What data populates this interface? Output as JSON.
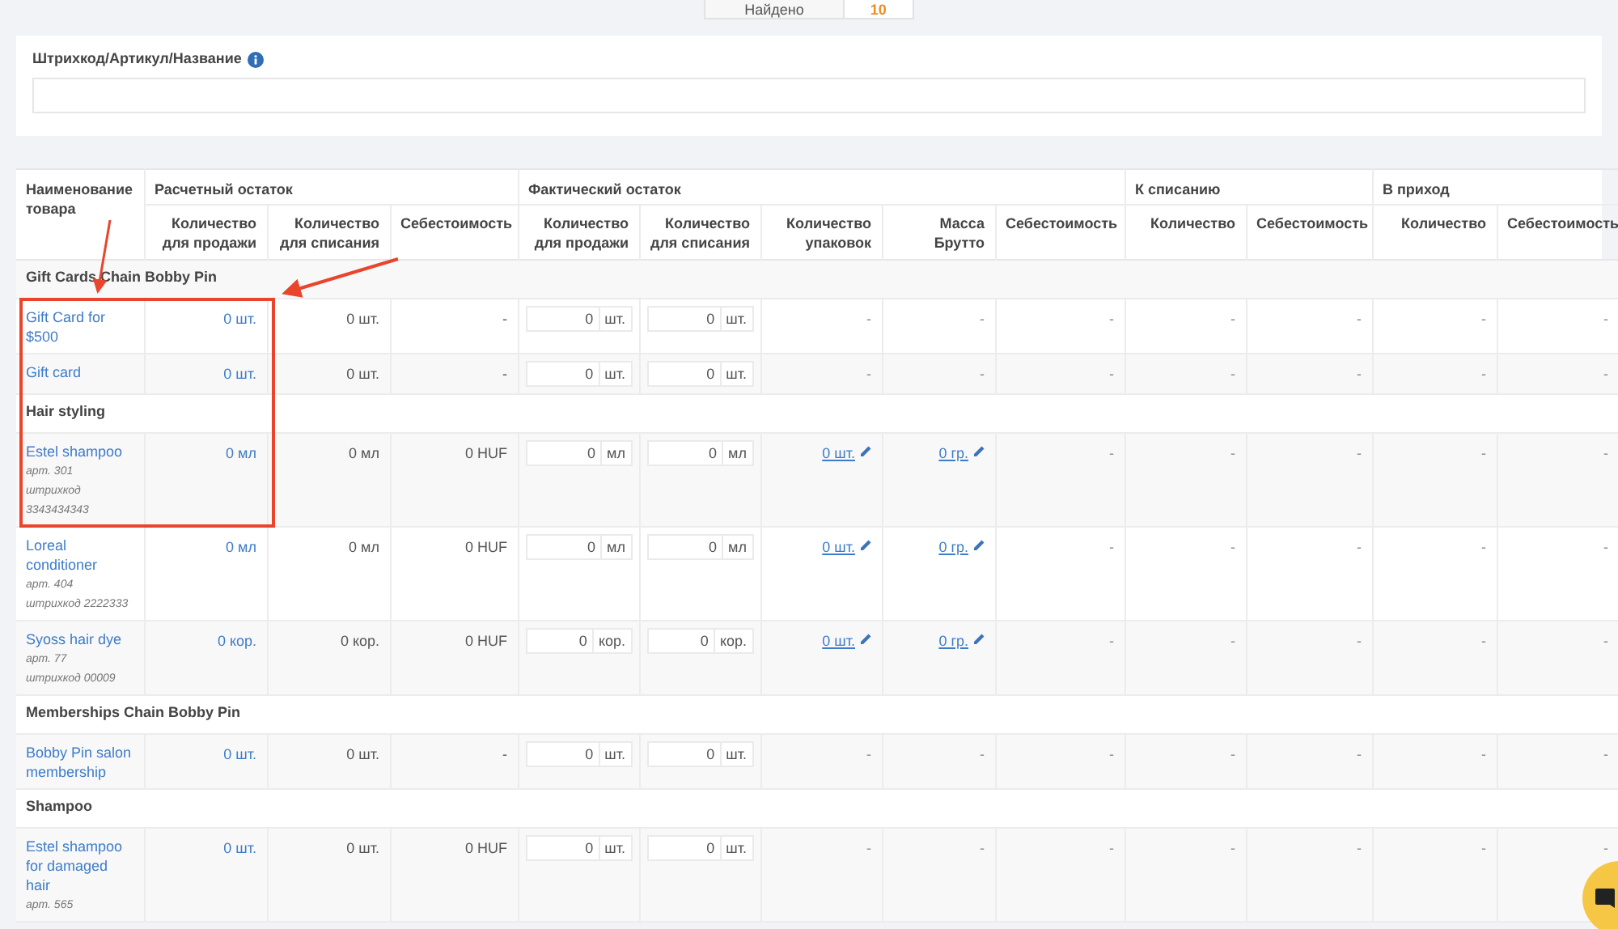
{
  "found": {
    "label": "Найдено",
    "count": "10"
  },
  "search": {
    "label": "Штрихкод/Артикул/Название"
  },
  "table": {
    "group_headers": [
      "Наименование товара",
      "Расчетный остаток",
      "Фактический остаток",
      "К списанию",
      "В приход"
    ],
    "sub_headers": [
      "Количество для продажи",
      "Количество для списания",
      "Себестоимость",
      "Количество для продажи",
      "Количество для списания",
      "Количество упаковок",
      "Масса Брутто",
      "Себестоимость",
      "Количество",
      "Себестоимость",
      "Количество",
      "Себестоимость"
    ],
    "rows": [
      {
        "kind": "group",
        "name": "Gift Cards Chain Bobby Pin"
      },
      {
        "kind": "item",
        "name": "Gift Card for $500",
        "calc": [
          "0 шт.",
          "0 шт.",
          "-"
        ],
        "inputs": [
          {
            "value": "0",
            "unit": "шт."
          },
          {
            "value": "0",
            "unit": "шт."
          }
        ],
        "rest": [
          {
            "kind": "text",
            "text": "-"
          },
          {
            "kind": "text",
            "text": "-"
          },
          {
            "kind": "text",
            "text": "-"
          },
          {
            "kind": "text",
            "text": "-"
          },
          {
            "kind": "text",
            "text": "-"
          },
          {
            "kind": "text",
            "text": "-"
          },
          {
            "kind": "text",
            "text": "-"
          }
        ]
      },
      {
        "kind": "item",
        "name": "Gift card",
        "calc": [
          "0 шт.",
          "0 шт.",
          "-"
        ],
        "inputs": [
          {
            "value": "0",
            "unit": "шт."
          },
          {
            "value": "0",
            "unit": "шт."
          }
        ],
        "rest": [
          {
            "kind": "text",
            "text": "-"
          },
          {
            "kind": "text",
            "text": "-"
          },
          {
            "kind": "text",
            "text": "-"
          },
          {
            "kind": "text",
            "text": "-"
          },
          {
            "kind": "text",
            "text": "-"
          },
          {
            "kind": "text",
            "text": "-"
          },
          {
            "kind": "text",
            "text": "-"
          }
        ]
      },
      {
        "kind": "group",
        "name": "Hair styling"
      },
      {
        "kind": "item",
        "name": "Estel shampoo",
        "meta": [
          "арт. 301",
          "штрихкод",
          "3343434343"
        ],
        "calc": [
          "0 мл",
          "0 мл",
          "0 HUF"
        ],
        "inputs": [
          {
            "value": "0",
            "unit": "мл"
          },
          {
            "value": "0",
            "unit": "мл"
          }
        ],
        "rest": [
          {
            "kind": "edit",
            "text": "0 шт."
          },
          {
            "kind": "edit",
            "text": "0 гр."
          },
          {
            "kind": "text",
            "text": "-"
          },
          {
            "kind": "text",
            "text": "-"
          },
          {
            "kind": "text",
            "text": "-"
          },
          {
            "kind": "text",
            "text": "-"
          },
          {
            "kind": "text",
            "text": "-"
          }
        ]
      },
      {
        "kind": "item",
        "name": "Loreal conditioner",
        "meta": [
          "арт. 404",
          "штрихкод 2222333"
        ],
        "calc": [
          "0 мл",
          "0 мл",
          "0 HUF"
        ],
        "inputs": [
          {
            "value": "0",
            "unit": "мл"
          },
          {
            "value": "0",
            "unit": "мл"
          }
        ],
        "rest": [
          {
            "kind": "edit",
            "text": "0 шт."
          },
          {
            "kind": "edit",
            "text": "0 гр."
          },
          {
            "kind": "text",
            "text": "-"
          },
          {
            "kind": "text",
            "text": "-"
          },
          {
            "kind": "text",
            "text": "-"
          },
          {
            "kind": "text",
            "text": "-"
          },
          {
            "kind": "text",
            "text": "-"
          }
        ]
      },
      {
        "kind": "item",
        "name": "Syoss hair dye",
        "meta": [
          "арт. 77",
          "штрихкод 00009"
        ],
        "calc": [
          "0 кор.",
          "0 кор.",
          "0 HUF"
        ],
        "inputs": [
          {
            "value": "0",
            "unit": "кор."
          },
          {
            "value": "0",
            "unit": "кор."
          }
        ],
        "rest": [
          {
            "kind": "edit",
            "text": "0 шт."
          },
          {
            "kind": "edit",
            "text": "0 гр."
          },
          {
            "kind": "text",
            "text": "-"
          },
          {
            "kind": "text",
            "text": "-"
          },
          {
            "kind": "text",
            "text": "-"
          },
          {
            "kind": "text",
            "text": "-"
          },
          {
            "kind": "text",
            "text": "-"
          }
        ]
      },
      {
        "kind": "group",
        "name": "Memberships Chain Bobby Pin"
      },
      {
        "kind": "item",
        "name": "Bobby Pin salon membership",
        "calc": [
          "0 шт.",
          "0 шт.",
          "-"
        ],
        "inputs": [
          {
            "value": "0",
            "unit": "шт."
          },
          {
            "value": "0",
            "unit": "шт."
          }
        ],
        "rest": [
          {
            "kind": "text",
            "text": "-"
          },
          {
            "kind": "text",
            "text": "-"
          },
          {
            "kind": "text",
            "text": "-"
          },
          {
            "kind": "text",
            "text": "-"
          },
          {
            "kind": "text",
            "text": "-"
          },
          {
            "kind": "text",
            "text": "-"
          },
          {
            "kind": "text",
            "text": "-"
          }
        ]
      },
      {
        "kind": "group",
        "name": "Shampoo"
      },
      {
        "kind": "item",
        "name": "Estel shampoo for damaged hair",
        "meta": [
          "арт. 565"
        ],
        "calc": [
          "0 шт.",
          "0 шт.",
          "0 HUF"
        ],
        "inputs": [
          {
            "value": "0",
            "unit": "шт."
          },
          {
            "value": "0",
            "unit": "шт."
          }
        ],
        "rest": [
          {
            "kind": "text",
            "text": "-"
          },
          {
            "kind": "text",
            "text": "-"
          },
          {
            "kind": "text",
            "text": "-"
          },
          {
            "kind": "text",
            "text": "-"
          },
          {
            "kind": "text",
            "text": "-"
          },
          {
            "kind": "text",
            "text": "-"
          },
          {
            "kind": "text",
            "text": "-"
          }
        ]
      }
    ]
  }
}
